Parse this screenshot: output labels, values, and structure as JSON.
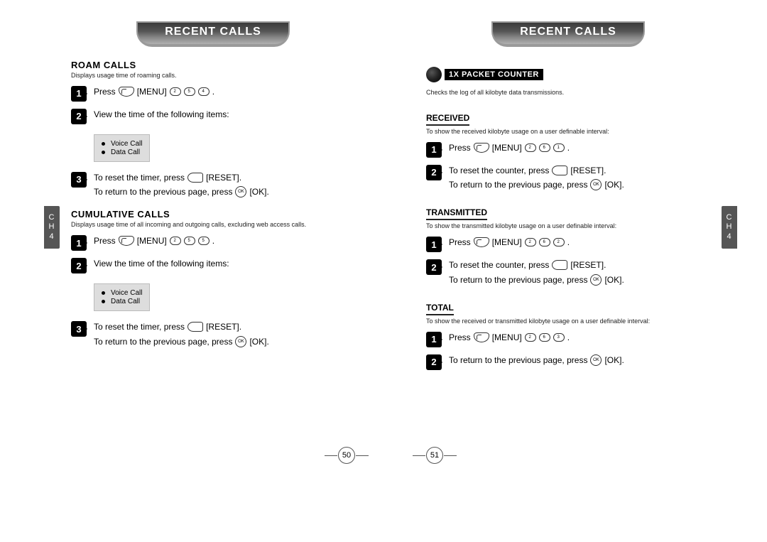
{
  "side_tab": {
    "c": "C",
    "h": "H",
    "n": "4"
  },
  "header": {
    "title": "RECENT CALLS"
  },
  "page_numbers": {
    "left": "50",
    "right": "51"
  },
  "left": {
    "roam": {
      "title": "ROAM CALLS",
      "note": "Displays usage time of roaming calls.",
      "step1_a": "Press",
      "step1_b": "[MENU]",
      "keys": [
        "2",
        "5",
        "4"
      ],
      "step1_c": ".",
      "step2": "View the time of the following items:",
      "items": [
        "Voice Call",
        "Data Call"
      ],
      "step3_a": "To reset the timer, press",
      "step3_b": "[RESET].",
      "step3_c": "To return to the previous page, press",
      "step3_d": "[OK]."
    },
    "cumulative": {
      "title": "CUMULATIVE CALLS",
      "note": "Displays usage time of all incoming and outgoing calls, excluding web access calls.",
      "step1_a": "Press",
      "step1_b": "[MENU]",
      "keys": [
        "2",
        "5",
        "5"
      ],
      "step1_c": ".",
      "step2": "View the time of the following items:",
      "items": [
        "Voice Call",
        "Data Call"
      ],
      "step3_a": "To reset the timer, press",
      "step3_b": "[RESET].",
      "step3_c": "To return to the previous page, press",
      "step3_d": "[OK]."
    }
  },
  "right": {
    "packet": {
      "label": "1X PACKET COUNTER",
      "note": "Checks the log of all kilobyte data transmissions."
    },
    "received": {
      "title": "RECEIVED",
      "note": "To show the received kilobyte usage on a user definable interval:",
      "step1_a": "Press",
      "step1_b": "[MENU]",
      "keys": [
        "2",
        "6",
        "1"
      ],
      "step1_c": ".",
      "step2_a": "To reset the counter, press",
      "step2_b": "[RESET].",
      "step2_c": "To return to the previous page, press",
      "step2_d": "[OK]."
    },
    "transmitted": {
      "title": "TRANSMITTED",
      "note": "To show the transmitted kilobyte usage on a user definable interval:",
      "step1_a": "Press",
      "step1_b": "[MENU]",
      "keys": [
        "2",
        "6",
        "2"
      ],
      "step1_c": ".",
      "step2_a": "To reset the counter, press",
      "step2_b": "[RESET].",
      "step2_c": "To return to the previous page, press",
      "step2_d": "[OK]."
    },
    "total": {
      "title": "TOTAL",
      "note": "To show the received or transmitted kilobyte usage on a user definable interval:",
      "step1_a": "Press",
      "step1_b": "[MENU]",
      "keys": [
        "2",
        "6",
        "3"
      ],
      "step1_c": ".",
      "step2_a": "To return to the previous page, press",
      "step2_b": "[OK]."
    }
  }
}
